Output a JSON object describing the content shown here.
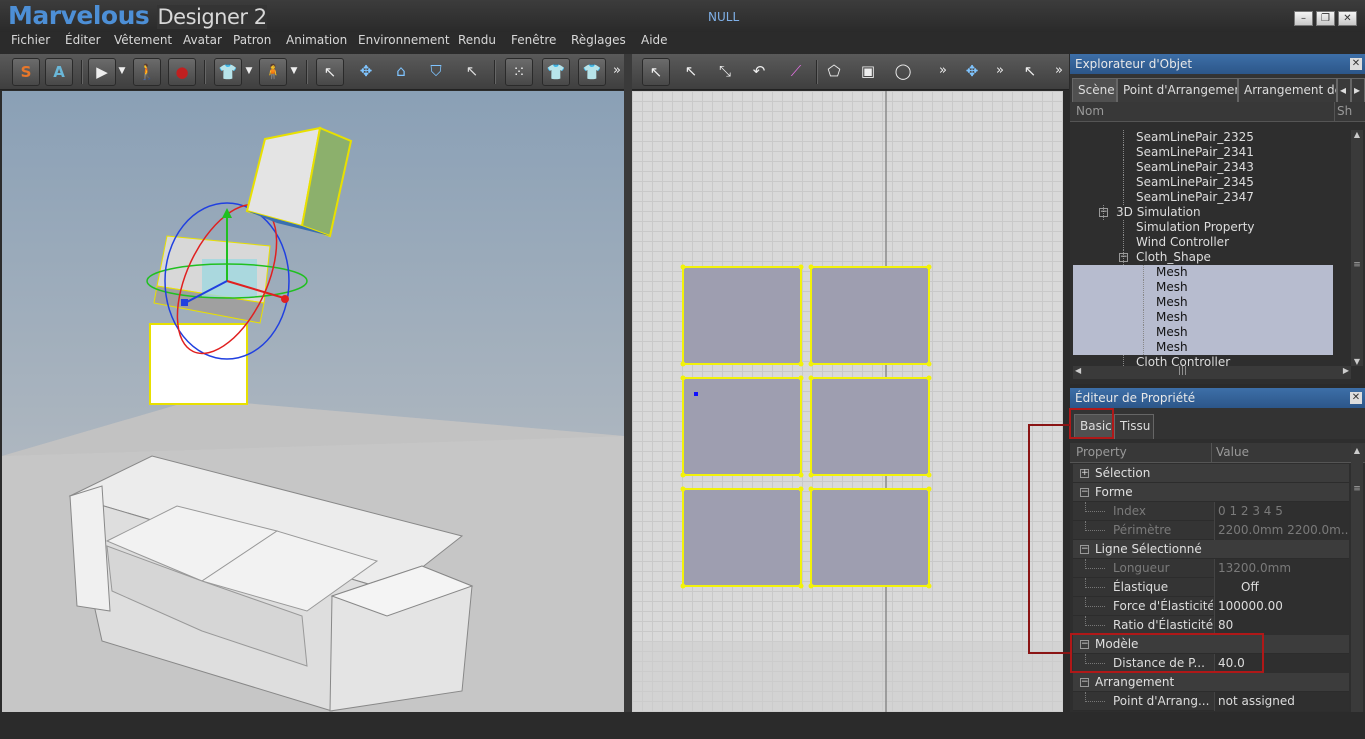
{
  "app": {
    "brand": "Marvelous",
    "brand_suffix": "Designer 2",
    "window_title": "NULL",
    "min": "–",
    "restore": "❐",
    "close": "✕"
  },
  "menu": [
    "Fichier",
    "Éditer",
    "Vêtement",
    "Avatar",
    "Patron",
    "Animation",
    "Environnement",
    "Rendu",
    "Fenêtre",
    "Règlages",
    "Aide"
  ],
  "toolbar": {
    "s_button": "S",
    "a_button": "A",
    "more": "»"
  },
  "object_explorer": {
    "title": "Explorateur d'Objet",
    "tabs": [
      "Scène",
      "Point d'Arrangement",
      "Arrangement de"
    ],
    "col_name": "Nom",
    "col_show": "Sh",
    "rows": [
      {
        "label": "SeamLinePair_2325",
        "indent": 3,
        "dot": true,
        "selected": false
      },
      {
        "label": "SeamLinePair_2341",
        "indent": 3,
        "dot": true,
        "selected": false
      },
      {
        "label": "SeamLinePair_2343",
        "indent": 3,
        "dot": true,
        "selected": false
      },
      {
        "label": "SeamLinePair_2345",
        "indent": 3,
        "dot": true,
        "selected": false
      },
      {
        "label": "SeamLinePair_2347",
        "indent": 3,
        "dot": true,
        "selected": false
      },
      {
        "label": "3D Simulation",
        "indent": 2,
        "dot": false,
        "selected": false
      },
      {
        "label": "Simulation Property",
        "indent": 3,
        "dot": false,
        "selected": false
      },
      {
        "label": "Wind Controller",
        "indent": 3,
        "dot": false,
        "selected": false
      },
      {
        "label": "Cloth_Shape",
        "indent": 3,
        "dot": false,
        "selected": false
      },
      {
        "label": "Mesh",
        "indent": 4,
        "dot": false,
        "selected": true
      },
      {
        "label": "Mesh",
        "indent": 4,
        "dot": false,
        "selected": true
      },
      {
        "label": "Mesh",
        "indent": 4,
        "dot": false,
        "selected": true
      },
      {
        "label": "Mesh",
        "indent": 4,
        "dot": false,
        "selected": true
      },
      {
        "label": "Mesh",
        "indent": 4,
        "dot": false,
        "selected": true
      },
      {
        "label": "Mesh",
        "indent": 4,
        "dot": false,
        "selected": true
      },
      {
        "label": "Cloth Controller",
        "indent": 3,
        "dot": false,
        "selected": false
      }
    ]
  },
  "property_editor": {
    "title": "Éditeur de Propriété",
    "tabs": [
      "Basic",
      "Tissu"
    ],
    "col_property": "Property",
    "col_value": "Value",
    "rows": [
      {
        "name": "Sélection",
        "value": "",
        "kind": "section",
        "toggle": "+"
      },
      {
        "name": "Forme",
        "value": "",
        "kind": "section",
        "toggle": "−"
      },
      {
        "name": "Index",
        "value": "0 1 2 3 4 5",
        "kind": "disabled"
      },
      {
        "name": "Périmètre",
        "value": "2200.0mm 2200.0m...",
        "kind": "disabled"
      },
      {
        "name": "Ligne Sélectionné",
        "value": "",
        "kind": "section",
        "toggle": "−"
      },
      {
        "name": "Longueur",
        "value": "13200.0mm",
        "kind": "disabled"
      },
      {
        "name": "Élastique",
        "value": "Off",
        "kind": "prop"
      },
      {
        "name": "Force d'Élasticité",
        "value": "100000.00",
        "kind": "prop"
      },
      {
        "name": "Ratio d'Élasticité",
        "value": "80",
        "kind": "prop"
      },
      {
        "name": "Modèle",
        "value": "",
        "kind": "section",
        "toggle": "−"
      },
      {
        "name": "Distance de P...",
        "value": "40.0",
        "kind": "prop"
      },
      {
        "name": "Arrangement",
        "value": "",
        "kind": "section",
        "toggle": "−"
      },
      {
        "name": "Point d'Arrang...",
        "value": "not assigned",
        "kind": "prop"
      }
    ]
  },
  "colors": {
    "brand": "#4d8fd6",
    "panel_title": "#2c5689",
    "highlight": "#b01818",
    "pattern_outline": "#f2f20a",
    "pattern_fill": "#9e9eb0"
  }
}
